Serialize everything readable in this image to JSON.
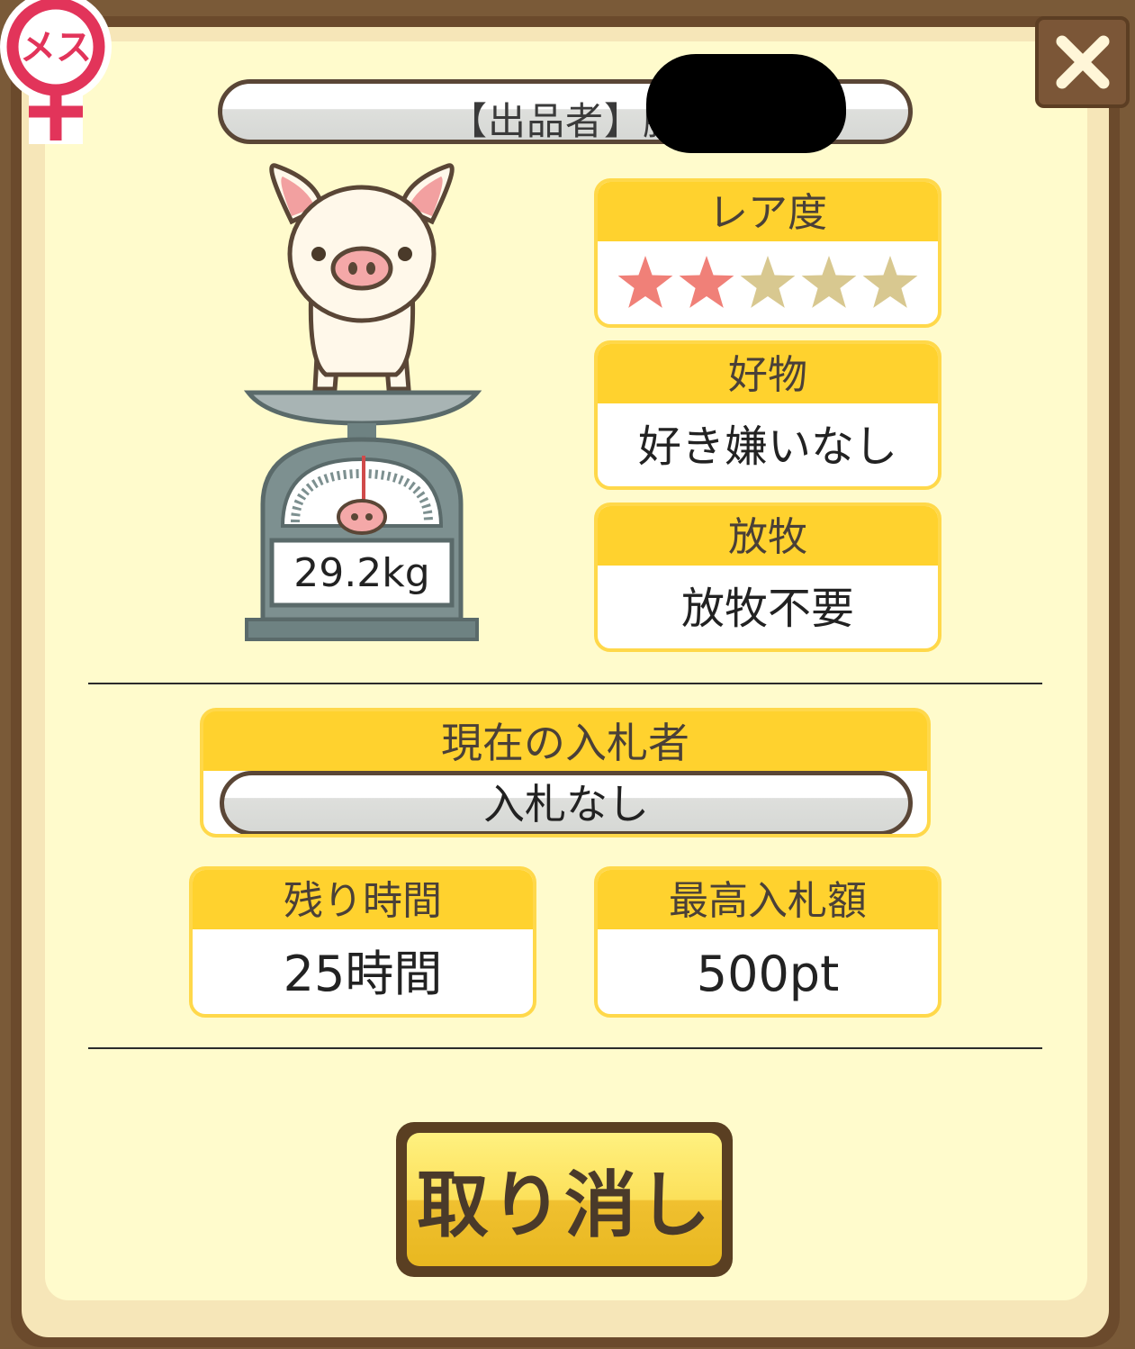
{
  "gender_badge": {
    "label": "メス"
  },
  "seller": {
    "label": "【出品者】豚"
  },
  "pig": {
    "weight": "29.2kg"
  },
  "rarity": {
    "title": "レア度",
    "rating": 2,
    "max": 5
  },
  "favorite_food": {
    "title": "好物",
    "value": "好き嫌いなし"
  },
  "grazing": {
    "title": "放牧",
    "value": "放牧不要"
  },
  "current_bidder": {
    "title": "現在の入札者",
    "value": "入札なし"
  },
  "remaining_time": {
    "title": "残り時間",
    "value": "25時間"
  },
  "highest_bid": {
    "title": "最高入札額",
    "value": "500pt"
  },
  "actions": {
    "cancel_label": "取り消し",
    "close_icon": "close-icon"
  },
  "colors": {
    "header_yellow": "#ffd22e",
    "panel_brown": "#6b4a2c",
    "face": "#fffbcc",
    "star_on": "#f08078",
    "star_off": "#d8c890"
  }
}
